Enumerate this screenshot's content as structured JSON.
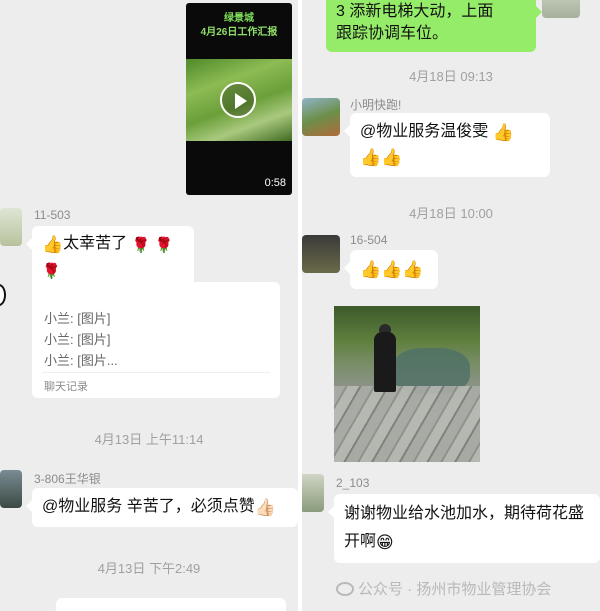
{
  "left": {
    "video": {
      "title1": "绿景城",
      "title2": "4月26日工作汇报",
      "duration": "0:58"
    },
    "msg_11503": {
      "name": "11-503",
      "text": "太幸苦了"
    },
    "record": {
      "lines": [
        "小兰: [图片]",
        "小兰: [图片]",
        "小兰: [图片..."
      ],
      "footer": "聊天记录"
    },
    "ts1": "4月13日 上午11:14",
    "msg_3806": {
      "name": "3-806王华银",
      "text": "@物业服务  辛苦了，必须点赞"
    },
    "ts2": "4月13日 下午2:49"
  },
  "right": {
    "top_bubble": {
      "line1": "3 添新电梯大动，上面",
      "line2": "跟踪协调车位。"
    },
    "ts1": "4月18日 09:13",
    "msg_xiaoming": {
      "name": "小明快跑!",
      "text": "@物业服务温俊雯"
    },
    "ts2": "4月18日 10:00",
    "msg_16504": {
      "name": "16-504"
    },
    "msg_2103": {
      "name": "2_103",
      "line1": "谢谢物业给水池加水，期待荷花盛",
      "line2": "开啊"
    },
    "watermark": "公众号 · 扬州市物业管理协会"
  },
  "icons": {
    "thumb": "👍",
    "rose": "🌹",
    "grin": "😁",
    "thumb_light": "👍🏻"
  }
}
